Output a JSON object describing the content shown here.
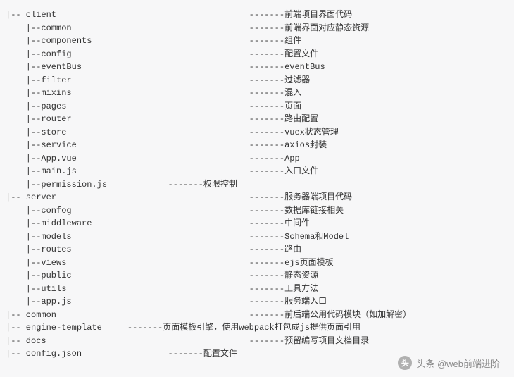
{
  "tree": [
    {
      "indent": 0,
      "name": "client",
      "dashLen": 7,
      "desc": "前端项目界面代码"
    },
    {
      "indent": 1,
      "name": "common",
      "dashLen": 7,
      "desc": "前端界面对应静态资源"
    },
    {
      "indent": 1,
      "name": "components",
      "dashLen": 7,
      "desc": "组件"
    },
    {
      "indent": 1,
      "name": "config",
      "dashLen": 7,
      "desc": "配置文件"
    },
    {
      "indent": 1,
      "name": "eventBus",
      "dashLen": 7,
      "desc": "eventBus"
    },
    {
      "indent": 1,
      "name": "filter",
      "dashLen": 7,
      "desc": "过滤器"
    },
    {
      "indent": 1,
      "name": "mixins",
      "dashLen": 7,
      "desc": "混入"
    },
    {
      "indent": 1,
      "name": "pages",
      "dashLen": 7,
      "desc": "页面"
    },
    {
      "indent": 1,
      "name": "router",
      "dashLen": 7,
      "desc": "路由配置"
    },
    {
      "indent": 1,
      "name": "store",
      "dashLen": 7,
      "desc": "vuex状态管理"
    },
    {
      "indent": 1,
      "name": "service",
      "dashLen": 7,
      "desc": "axios封装"
    },
    {
      "indent": 1,
      "name": "App.vue",
      "dashLen": 7,
      "desc": "App"
    },
    {
      "indent": 1,
      "name": "main.js",
      "dashLen": 7,
      "desc": "入口文件"
    },
    {
      "indent": 1,
      "name": "permission.js",
      "dashLen": 7,
      "desc": "权限控制",
      "descShift": -16
    },
    {
      "indent": 0,
      "name": "server",
      "dashLen": 7,
      "desc": "服务器端项目代码"
    },
    {
      "indent": 1,
      "name": "confog",
      "dashLen": 7,
      "desc": "数据库链接相关"
    },
    {
      "indent": 1,
      "name": "middleware",
      "dashLen": 7,
      "desc": "中间件"
    },
    {
      "indent": 1,
      "name": "models",
      "dashLen": 7,
      "desc": "Schema和Model"
    },
    {
      "indent": 1,
      "name": "routes",
      "dashLen": 7,
      "desc": "路由"
    },
    {
      "indent": 1,
      "name": "views",
      "dashLen": 7,
      "desc": "ejs页面模板"
    },
    {
      "indent": 1,
      "name": "public",
      "dashLen": 7,
      "desc": "静态资源"
    },
    {
      "indent": 1,
      "name": "utils",
      "dashLen": 7,
      "desc": "工具方法"
    },
    {
      "indent": 1,
      "name": "app.js",
      "dashLen": 7,
      "desc": "服务端入口"
    },
    {
      "indent": 0,
      "name": "common",
      "dashLen": 7,
      "desc": "前后端公用代码模块（如加解密）"
    },
    {
      "indent": 0,
      "name": "engine-template",
      "dashLen": 7,
      "desc": "页面模板引擎，使用webpack打包成js提供页面引用",
      "descShift": -24
    },
    {
      "indent": 0,
      "name": "docs",
      "dashLen": 7,
      "desc": "预留编写项目文档目录"
    },
    {
      "indent": 0,
      "name": "config.json",
      "dashLen": 7,
      "desc": "配置文件",
      "descShift": -16
    }
  ],
  "watermark": {
    "label": "头条 @web前端进阶"
  }
}
